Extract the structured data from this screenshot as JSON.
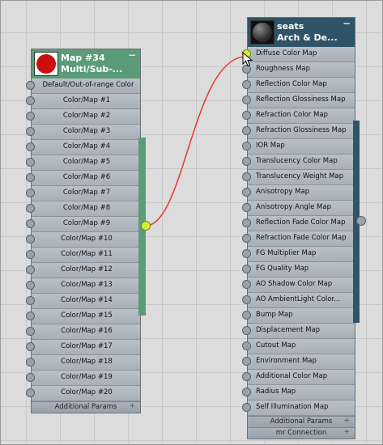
{
  "colors": {
    "left_header": "#5a9c78",
    "right_header": "#2f5468",
    "left_swatch": "#cc0d0d",
    "wire": "#e5413a",
    "connected_slot": "#d9ef2e"
  },
  "left_node": {
    "title": "Map #34",
    "subtitle": "Multi/Sub-...",
    "collapse_label": "−",
    "rows": [
      "Default/Out-of-range Color",
      "Color/Map #1",
      "Color/Map #2",
      "Color/Map #3",
      "Color/Map #4",
      "Color/Map #5",
      "Color/Map #6",
      "Color/Map #7",
      "Color/Map #8",
      "Color/Map #9",
      "Color/Map #10",
      "Color/Map #11",
      "Color/Map #12",
      "Color/Map #13",
      "Color/Map #14",
      "Color/Map #15",
      "Color/Map #16",
      "Color/Map #17",
      "Color/Map #18",
      "Color/Map #19",
      "Color/Map #20"
    ],
    "footers": [
      "Additional Params"
    ]
  },
  "right_node": {
    "title": "seats",
    "subtitle": "Arch & De...",
    "collapse_label": "−",
    "rows": [
      "Diffuse Color Map",
      "Roughness Map",
      "Reflection Color Map",
      "Reflection Glossiness Map",
      "Refraction Color Map",
      "Refraction Glossiness Map",
      "IOR Map",
      "Translucency Color Map",
      "Translucency Weight Map",
      "Anisotropy Map",
      "Anisotropy Angle Map",
      "Reflection Fade Color Map",
      "Refraction Fade Color Map",
      "FG Multiplier Map",
      "FG Quality Map",
      "AO Shadow Color Map",
      "AO AmbientLight Color...",
      "Bump Map",
      "Displacement Map",
      "Cutout Map",
      "Environment Map",
      "Additional Color Map",
      "Radius Map",
      "Self Illumination Map"
    ],
    "footers": [
      "Additional Params",
      "mr Connection"
    ],
    "connected_input": "Diffuse Color Map"
  },
  "footer_expand_label": "+"
}
